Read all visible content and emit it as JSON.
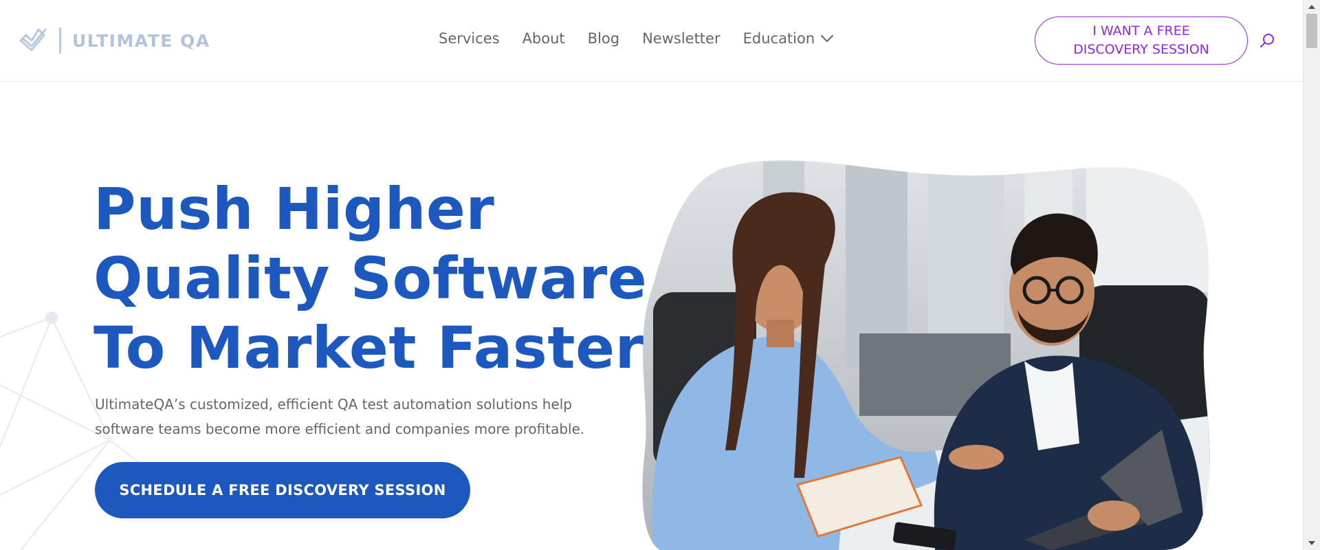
{
  "header": {
    "logo_text": "ULTIMATE QA",
    "nav": [
      {
        "label": "Services"
      },
      {
        "label": "About"
      },
      {
        "label": "Blog"
      },
      {
        "label": "Newsletter"
      },
      {
        "label": "Education",
        "has_dropdown": true
      }
    ],
    "cta_line1": "I WANT A FREE",
    "cta_line2": "DISCOVERY SESSION",
    "search_icon": "search-icon"
  },
  "hero": {
    "title_line1": "Push Higher",
    "title_line2": "Quality Software",
    "title_line3": "To Market Faster",
    "subtitle": "UltimateQA’s customized, efficient QA test automation solutions help software teams become more efficient and companies more profitable.",
    "cta_label": "SCHEDULE A FREE DISCOVERY SESSION",
    "image_icon": "hero-photo-two-colleagues-laptop"
  },
  "colors": {
    "brand_blue": "#1c58bd",
    "accent_purple": "#8b2be2",
    "logo_gray_blue": "#b4c3dc",
    "nav_text": "#666666"
  }
}
